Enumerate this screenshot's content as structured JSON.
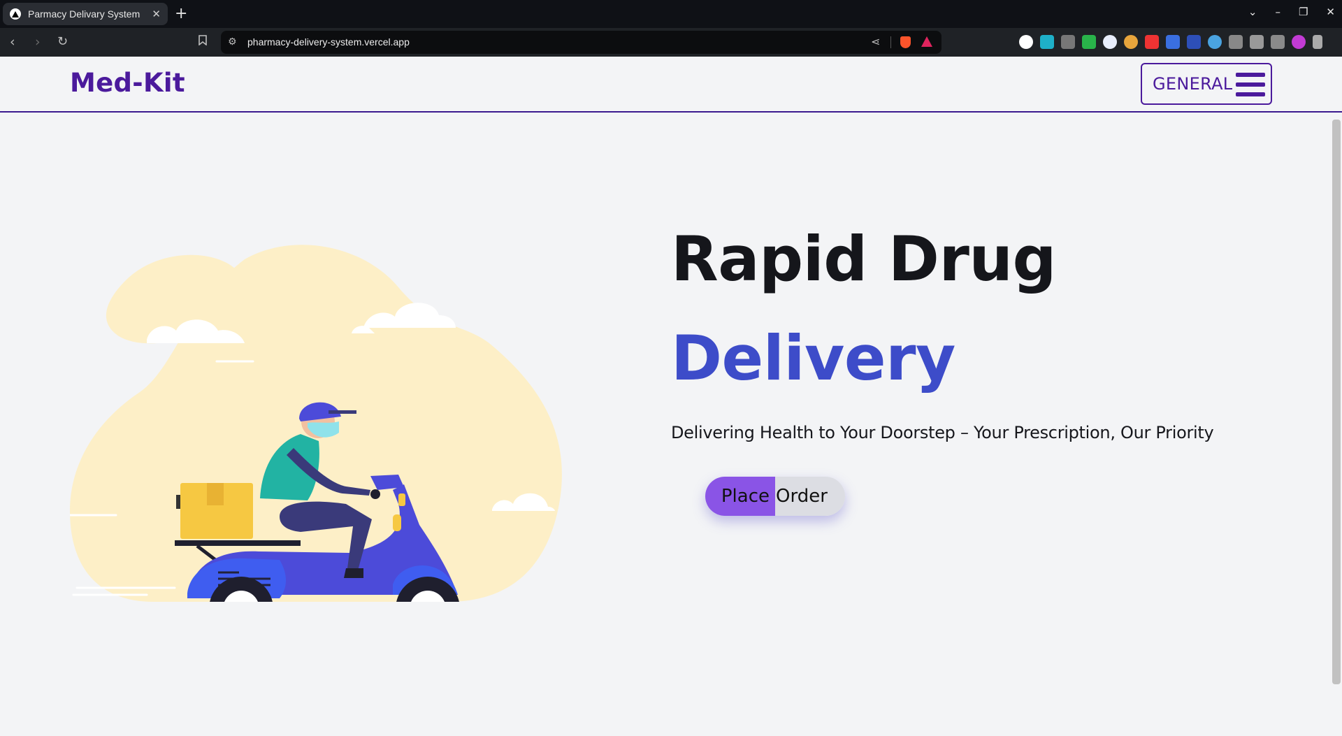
{
  "browser": {
    "tab_title": "Parmacy Delivary System",
    "tab_close_icon": "close-icon",
    "new_tab_icon": "plus-icon",
    "url": "pharmacy-delivery-system.vercel.app",
    "window_controls": [
      "minimize-icon",
      "restore-icon",
      "close-icon"
    ]
  },
  "site": {
    "logo": "Med-Kit",
    "menu_label": "GENERAL",
    "brand_color": "#4b1a9c",
    "accent_color": "#3d4cc9"
  },
  "hero": {
    "title_line1": "Rapid Drug",
    "title_line2": "Delivery",
    "tagline": "Delivering Health to Your Doorstep – Your Prescription, Our Priority",
    "cta_word1": "Place",
    "cta_word2": "Order",
    "illustration": "delivery-scooter-illustration"
  }
}
